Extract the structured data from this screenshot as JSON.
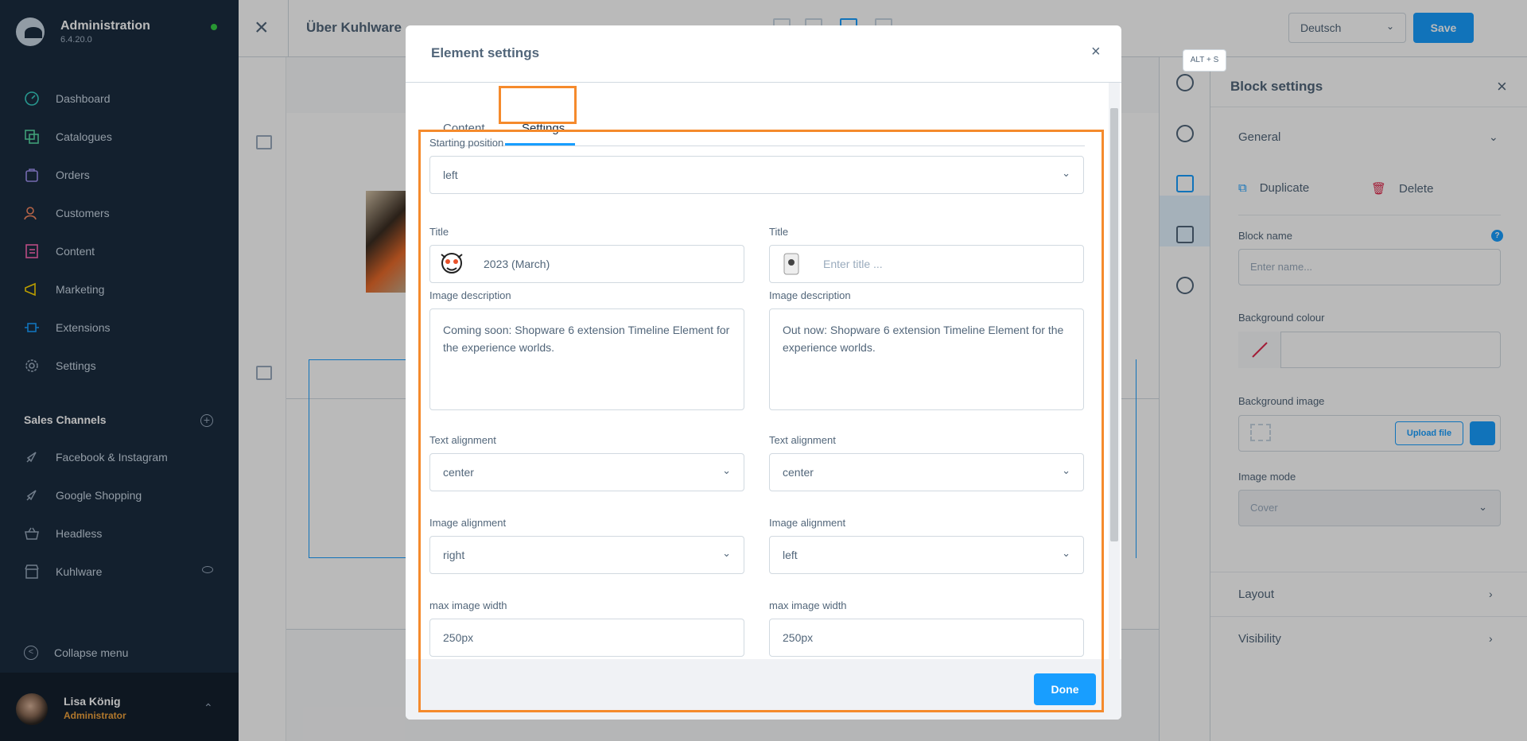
{
  "app": {
    "title": "Administration",
    "version": "6.4.20.0"
  },
  "nav": [
    {
      "label": "Dashboard",
      "icon": "dashboard-icon",
      "color": "#37d0c4"
    },
    {
      "label": "Catalogues",
      "icon": "catalogue-icon",
      "color": "#57d9a3"
    },
    {
      "label": "Orders",
      "icon": "orders-icon",
      "color": "#a092f0"
    },
    {
      "label": "Customers",
      "icon": "customers-icon",
      "color": "#f88962"
    },
    {
      "label": "Content",
      "icon": "content-icon",
      "color": "#ff68b4"
    },
    {
      "label": "Marketing",
      "icon": "marketing-icon",
      "color": "#ffd700"
    },
    {
      "label": "Extensions",
      "icon": "extensions-icon",
      "color": "#189eff"
    },
    {
      "label": "Settings",
      "icon": "settings-icon",
      "color": "#9aabbd"
    }
  ],
  "sales_channels": {
    "heading": "Sales Channels",
    "items": [
      "Facebook & Instagram",
      "Google Shopping",
      "Headless",
      "Kuhlware"
    ]
  },
  "collapse_label": "Collapse menu",
  "user": {
    "name": "Lisa König",
    "role": "Administrator"
  },
  "topbar": {
    "page_title": "Über Kuhlware",
    "language": "Deutsch",
    "save_label": "Save",
    "save_shortcut": "ALT + S"
  },
  "block_panel": {
    "title": "Block settings",
    "general": "General",
    "duplicate": "Duplicate",
    "delete": "Delete",
    "block_name_label": "Block name",
    "block_name_placeholder": "Enter name...",
    "bg_colour_label": "Background colour",
    "bg_image_label": "Background image",
    "upload_label": "Upload file",
    "image_mode_label": "Image mode",
    "image_mode_value": "Cover",
    "layout": "Layout",
    "visibility": "Visibility"
  },
  "modal": {
    "title": "Element settings",
    "tabs": [
      "Content",
      "Settings"
    ],
    "active_tab": "Settings",
    "starting_position_label": "Starting position",
    "starting_position_value": "left",
    "columns": [
      {
        "title_label": "Title",
        "title_value": "2023 (March)",
        "title_placeholder": "",
        "image_desc_label": "Image description",
        "image_desc_value": "Coming soon: Shopware 6 extension Timeline Element for the experience worlds.",
        "text_align_label": "Text alignment",
        "text_align_value": "center",
        "image_align_label": "Image alignment",
        "image_align_value": "right",
        "max_width_label": "max image width",
        "max_width_value": "250px"
      },
      {
        "title_label": "Title",
        "title_value": "",
        "title_placeholder": "Enter title ...",
        "image_desc_label": "Image description",
        "image_desc_value": "Out now: Shopware 6 extension Timeline Element for the experience worlds.",
        "text_align_label": "Text alignment",
        "text_align_value": "center",
        "image_align_label": "Image alignment",
        "image_align_value": "left",
        "max_width_label": "max image width",
        "max_width_value": "250px"
      }
    ],
    "done_label": "Done"
  },
  "colors": {
    "accent": "#189eff",
    "highlight": "#f58a2c",
    "sidebar": "#1b2c40"
  }
}
